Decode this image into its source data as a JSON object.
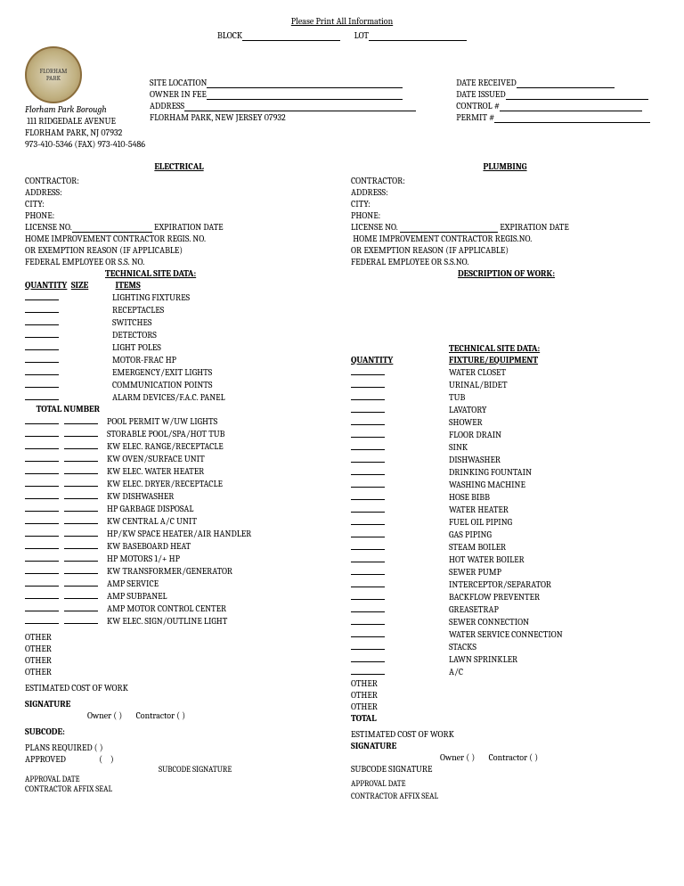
{
  "header": {
    "print_all": "Please Print All Information",
    "block": "BLOCK",
    "lot": "LOT"
  },
  "org": {
    "name": "Florham Park Borough",
    "addr1": "111 RIDGEDALE AVENUE",
    "addr2": "FLORHAM PARK, NJ 07932",
    "phone": "973-410-5346 (FAX) 973-410-5486"
  },
  "midlabels": {
    "site": "SITE LOCATION",
    "owner": "OWNER IN FEE",
    "address": "ADDRESS",
    "cityline": "FLORHAM PARK, NEW JERSEY 07932"
  },
  "rightlabels": {
    "date_received": "DATE RECEIVED",
    "date_issued": "DATE ISSUED",
    "control": "CONTROL #",
    "permit": "PERMIT #"
  },
  "elec_title": "ELECTRICAL",
  "plumb_title": "PLUMBING",
  "contractor_block": {
    "contractor": "CONTRACTOR:",
    "address": "ADDRESS:",
    "city": "CITY:",
    "phone": "PHONE:",
    "license": "LICENSE NO.",
    "expiration": "EXPIRATION DATE",
    "home_imp": "HOME IMPROVEMENT CONTRACTOR REGIS. NO.",
    "home_imp2": "HOME IMPROVEMENT CONTRACTOR REGIS.NO.",
    "exemption": "OR EXEMPTION REASON (IF APPLICABLE)",
    "federal": "FEDERAL EMPLOYEE OR S.S. NO.",
    "federal2": "FEDERAL EMPLOYEE OR S.S.NO."
  },
  "elec": {
    "tech_title": "TECHNICAL SITE  DATA:",
    "qty": "QUANTITY",
    "size": "SIZE",
    "items_hdr": "ITEMS",
    "items1": [
      "LIGHTING FIXTURES",
      "RECEPTACLES",
      "SWITCHES",
      "DETECTORS",
      "LIGHT POLES",
      "MOTOR-FRAC HP",
      "EMERGENCY/EXIT LIGHTS",
      "COMMUNICATION POINTS",
      "ALARM DEVICES/F.A.C. PANEL"
    ],
    "total_number": "TOTAL NUMBER",
    "items2": [
      "POOL PERMIT W/UW LIGHTS",
      "STORABLE POOL/SPA/HOT TUB",
      "KW ELEC. RANGE/RECEPTACLE",
      "KW OVEN/SURFACE UNIT",
      "KW ELEC. WATER HEATER",
      "KW ELEC. DRYER/RECEPTACLE",
      "KW DISHWASHER",
      "HP GARBAGE DISPOSAL",
      "KW CENTRAL A/C UNIT",
      "HP/KW SPACE HEATER/AIR HANDLER",
      "KW BASEBOARD HEAT",
      "HP MOTORS 1/+ HP",
      "KW TRANSFORMER/GENERATOR",
      " AMP SERVICE",
      "AMP SUBPANEL",
      "AMP MOTOR CONTROL CENTER",
      "KW ELEC. SIGN/OUTLINE LIGHT"
    ],
    "other": "OTHER",
    "est_cost": "ESTIMATED COST OF WORK",
    "signature": "SIGNATURE",
    "owner_cb": "Owner  (    )",
    "contractor_cb": "Contractor (    )",
    "subcode": "SUBCODE:",
    "plans_required": "PLANS  REQUIRED   (    )",
    "approved": "APPROVED",
    "subcode_sig": "SUBCODE SIGNATURE",
    "approval_date": "APPROVAL DATE",
    "affix": "CONTRACTOR AFFIX SEAL"
  },
  "plumb": {
    "desc_title": "DESCRIPTION OF WORK:",
    "tech_title": "TECHNICAL SITE DATA:",
    "qty": "QUANTITY",
    "fixture_hdr": "FIXTURE/EQUIPMENT",
    "items": [
      "WATER CLOSET",
      "URINAL/BIDET",
      "TUB",
      "LAVATORY",
      "SHOWER",
      "FLOOR DRAIN",
      "SINK",
      "DISHWASHER",
      "DRINKING FOUNTAIN",
      "WASHING MACHINE",
      "HOSE BIBB",
      "WATER HEATER",
      "FUEL OIL PIPING",
      "GAS PIPING",
      "STEAM BOILER",
      "HOT WATER BOILER",
      "SEWER PUMP",
      "INTERCEPTOR/SEPARATOR",
      "BACKFLOW PREVENTER",
      "GREASETRAP",
      "SEWER CONNECTION",
      "WATER SERVICE CONNECTION",
      "STACKS",
      "LAWN SPRINKLER",
      "A/C"
    ],
    "other": "OTHER",
    "total": "TOTAL",
    "est_cost": "ESTIMATED COST OF WORK",
    "signature": "SIGNATURE",
    "owner_cb": "Owner (    )",
    "contractor_cb": "Contractor   (    )",
    "subcode_sig_label": "SUBCODE SIGNATURE",
    "approval_date": "APPROVAL DATE",
    "affix": "CONTRACTOR AFFIX SEAL"
  }
}
